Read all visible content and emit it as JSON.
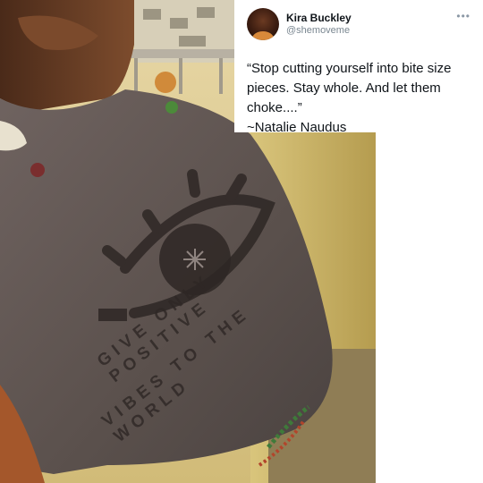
{
  "tweet": {
    "display_name": "Kira Buckley",
    "handle": "@shemoveme",
    "text": "“Stop cutting yourself into bite size pieces. Stay whole. And let them choke....”\n~Natalie Naudus"
  },
  "photo": {
    "shirt_text_line1": "GIVE ONLY POSITIVE",
    "shirt_text_line2": "VIBES TO THE WORLD",
    "colors": {
      "wall": "#c7b56d",
      "shirt": "#5e5450",
      "skin": "#6a3f27",
      "ground": "#8b7a55"
    }
  },
  "icons": {
    "more": "more-horizontal-icon",
    "eye": "eye-graphic-icon"
  }
}
